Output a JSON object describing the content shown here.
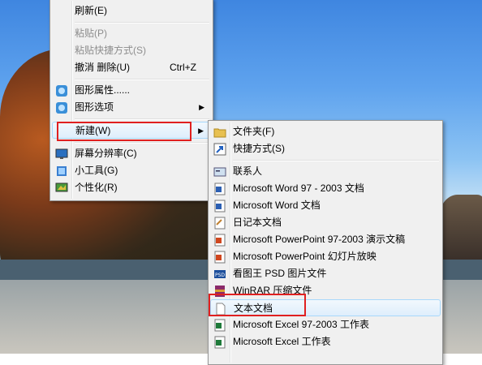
{
  "context_menu": {
    "items": [
      {
        "label": "刷新(E)"
      },
      {
        "label": "粘贴(P)"
      },
      {
        "label": "粘贴快捷方式(S)"
      },
      {
        "label": "撤消 删除(U)",
        "shortcut": "Ctrl+Z"
      },
      {
        "label": "图形属性......"
      },
      {
        "label": "图形选项"
      },
      {
        "label": "新建(W)"
      },
      {
        "label": "屏幕分辨率(C)"
      },
      {
        "label": "小工具(G)"
      },
      {
        "label": "个性化(R)"
      }
    ]
  },
  "submenu": {
    "items": [
      {
        "label": "文件夹(F)"
      },
      {
        "label": "快捷方式(S)"
      },
      {
        "label": "联系人"
      },
      {
        "label": "Microsoft Word 97 - 2003 文档"
      },
      {
        "label": "Microsoft Word 文档"
      },
      {
        "label": "日记本文档"
      },
      {
        "label": "Microsoft PowerPoint 97-2003 演示文稿"
      },
      {
        "label": "Microsoft PowerPoint 幻灯片放映"
      },
      {
        "label": "看图王 PSD 图片文件"
      },
      {
        "label": "WinRAR 压缩文件"
      },
      {
        "label": "文本文档"
      },
      {
        "label": "Microsoft Excel 97-2003 工作表"
      },
      {
        "label": "Microsoft Excel 工作表"
      }
    ]
  },
  "colors": {
    "highlight_box": "#e02020",
    "menu_bg": "#f0f0f0"
  }
}
